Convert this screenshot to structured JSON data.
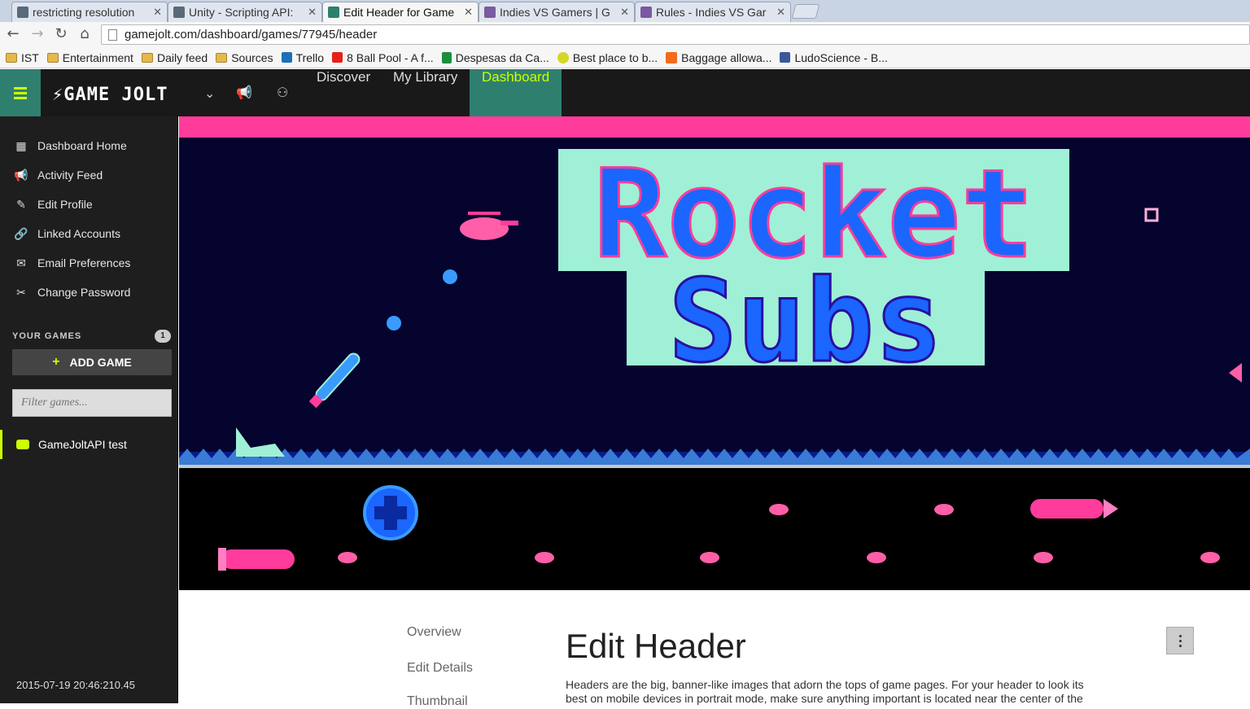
{
  "browser": {
    "tabs": [
      {
        "title": "restricting resolution",
        "active": false,
        "favicon_color": "#5a6a7a"
      },
      {
        "title": "Unity - Scripting API:",
        "active": false,
        "favicon_color": "#5a6a7a"
      },
      {
        "title": "Edit Header for Game",
        "active": true,
        "favicon_color": "#2f7f6f"
      },
      {
        "title": "Indies VS Gamers | G",
        "active": false,
        "favicon_color": "#7a5aa0"
      },
      {
        "title": "Rules - Indies VS Gar",
        "active": false,
        "favicon_color": "#7a5aa0"
      }
    ],
    "url": "gamejolt.com/dashboard/games/77945/header",
    "bookmarks": [
      {
        "label": "IST",
        "icon": "folder-icon"
      },
      {
        "label": "Entertainment",
        "icon": "folder-icon"
      },
      {
        "label": "Daily feed",
        "icon": "folder-icon"
      },
      {
        "label": "Sources",
        "icon": "folder-icon"
      },
      {
        "label": "Trello",
        "icon": "trello-icon"
      },
      {
        "label": "8 Ball Pool - A f...",
        "icon": "youtube-icon"
      },
      {
        "label": "Despesas da Ca...",
        "icon": "sheets-icon"
      },
      {
        "label": "Best place to b...",
        "icon": "smiley-icon"
      },
      {
        "label": "Baggage allowa...",
        "icon": "e-icon"
      },
      {
        "label": "LudoScience - B...",
        "icon": "facebook-icon"
      }
    ]
  },
  "topnav": {
    "logo": "GAME JOLT",
    "links": [
      {
        "label": "Discover",
        "active": false
      },
      {
        "label": "My Library",
        "active": false
      },
      {
        "label": "Dashboard",
        "active": true
      }
    ]
  },
  "sidebar": {
    "items": [
      {
        "label": "Dashboard Home",
        "icon": "dashboard-icon"
      },
      {
        "label": "Activity Feed",
        "icon": "megaphone-icon"
      },
      {
        "label": "Edit Profile",
        "icon": "pencil-icon"
      },
      {
        "label": "Linked Accounts",
        "icon": "link-icon"
      },
      {
        "label": "Email Preferences",
        "icon": "envelope-icon"
      },
      {
        "label": "Change Password",
        "icon": "tools-icon"
      }
    ],
    "your_games_label": "YOUR GAMES",
    "your_games_count": "1",
    "add_game_label": "ADD GAME",
    "filter_placeholder": "Filter games...",
    "games": [
      {
        "label": "GameJoltAPI test",
        "icon": "gamepad-icon"
      }
    ]
  },
  "banner": {
    "title_line1": "Rocket",
    "title_line2": "Subs",
    "colors": {
      "sky": "#04042e",
      "sea": "#000000",
      "title_fill": "#1a66ff",
      "title_outline": "#9ff0d6",
      "accent": "#ff3c9c",
      "strip": "#ff3c9c"
    }
  },
  "content": {
    "subnav": [
      "Overview",
      "Edit Details",
      "Thumbnail"
    ],
    "title": "Edit Header",
    "description": "Headers are the big, banner-like images that adorn the tops of game pages. For your header to look its best on mobile devices in portrait mode, make sure anything important is located near the center of the"
  },
  "timestamp": "2015-07-19 20:46:210.45"
}
